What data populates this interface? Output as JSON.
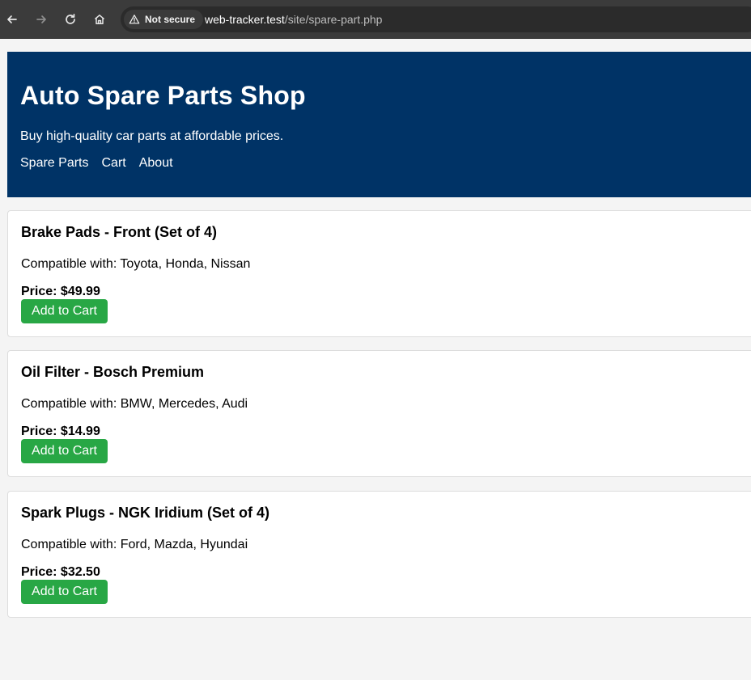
{
  "browser": {
    "security_label": "Not secure",
    "url_host": "web-tracker.test",
    "url_path": "/site/spare-part.php",
    "icons": {
      "back": "back-arrow-icon",
      "forward": "forward-arrow-icon",
      "reload": "reload-icon",
      "home": "home-icon",
      "warning": "warning-triangle-icon"
    }
  },
  "site": {
    "title": "Auto Spare Parts Shop",
    "tagline": "Buy high-quality car parts at affordable prices.",
    "nav": [
      {
        "label": "Spare Parts"
      },
      {
        "label": "Cart"
      },
      {
        "label": "About"
      }
    ],
    "colors": {
      "header_bg": "#003366",
      "button_bg": "#28a745",
      "page_bg": "#f4f4f4"
    }
  },
  "products": [
    {
      "name": "Brake Pads - Front (Set of 4)",
      "compatibility": "Compatible with: Toyota, Honda, Nissan",
      "price": "Price: $49.99",
      "button": "Add to Cart"
    },
    {
      "name": "Oil Filter - Bosch Premium",
      "compatibility": "Compatible with: BMW, Mercedes, Audi",
      "price": "Price: $14.99",
      "button": "Add to Cart"
    },
    {
      "name": "Spark Plugs - NGK Iridium (Set of 4)",
      "compatibility": "Compatible with: Ford, Mazda, Hyundai",
      "price": "Price: $32.50",
      "button": "Add to Cart"
    }
  ]
}
